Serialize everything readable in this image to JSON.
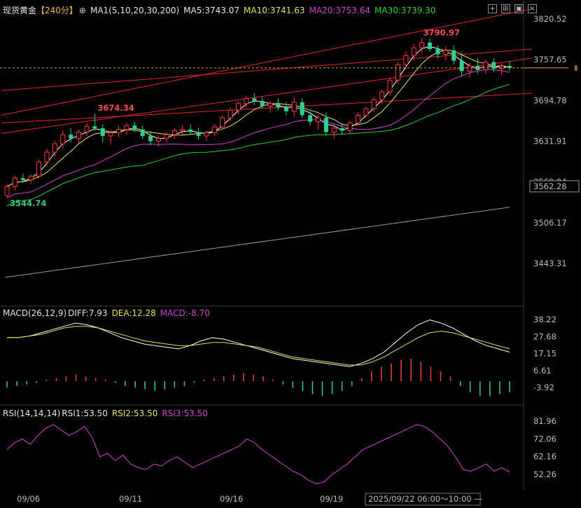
{
  "header": {
    "instrument": "现货黄金",
    "period": "【240分】",
    "zoom_icon": "zoom-in-icon",
    "ma_params": "MA1(5,10,20,30,200)",
    "ma5": "MA5:3743.07",
    "ma10": "MA10:3741.63",
    "ma20": "MA20:3753.64",
    "ma30": "MA30:3739.30"
  },
  "toolbar_icons": [
    "crosshair-icon",
    "split-icon",
    "image-icon",
    "close-icon"
  ],
  "price_axis": [
    "3820.52",
    "3757.65",
    "3694.78",
    "3631.91",
    "3569.04",
    "3506.17",
    "3443.31"
  ],
  "current_price": "3562.28",
  "markers": {
    "high": "3790.97",
    "mid": "3674.34",
    "low": "3544.74"
  },
  "macd": {
    "params": "MACD(26,12,9)",
    "diff": "DIFF:7.93",
    "dea": "DEA:12.28",
    "macd": "MACD:-8.70",
    "axis": [
      "38.22",
      "27.68",
      "17.15",
      "6.61",
      "-3.92"
    ]
  },
  "rsi": {
    "params": "RSI(14,14,14)",
    "rsi1": "RSI1:53.50",
    "rsi2": "RSI2:53.50",
    "rsi3": "RSI3:53.50",
    "axis": [
      "81.96",
      "72.06",
      "62.16",
      "52.26"
    ]
  },
  "dates": [
    "09/06",
    "09/11",
    "09/16",
    "09/19"
  ],
  "cursor_time": "2025/09/22 06:00～10:00",
  "colors": {
    "up": "#ff3b3b",
    "down": "#2fd08f",
    "ma5": "#ffffff",
    "ma10": "#e6e24f",
    "ma20": "#d23fd2",
    "ma30": "#21d321",
    "ma200": "#9a9a9a",
    "channel": "#e8222a"
  },
  "chart_data": {
    "type": "candlestick",
    "y_range": [
      3420,
      3835
    ],
    "candles": [
      [
        3548,
        3566,
        3544.74,
        3562
      ],
      [
        3562,
        3578,
        3556,
        3575
      ],
      [
        3575,
        3582,
        3568,
        3572
      ],
      [
        3572,
        3580,
        3566,
        3578
      ],
      [
        3578,
        3604,
        3575,
        3600
      ],
      [
        3600,
        3620,
        3595,
        3615
      ],
      [
        3615,
        3632,
        3608,
        3628
      ],
      [
        3628,
        3648,
        3620,
        3642
      ],
      [
        3642,
        3652,
        3630,
        3636
      ],
      [
        3636,
        3650,
        3628,
        3646
      ],
      [
        3646,
        3660,
        3640,
        3655
      ],
      [
        3655,
        3674.34,
        3648,
        3652
      ],
      [
        3652,
        3658,
        3630,
        3640
      ],
      [
        3640,
        3650,
        3628,
        3645
      ],
      [
        3645,
        3656,
        3638,
        3650
      ],
      [
        3650,
        3660,
        3642,
        3656
      ],
      [
        3656,
        3662,
        3646,
        3650
      ],
      [
        3650,
        3656,
        3636,
        3640
      ],
      [
        3640,
        3648,
        3626,
        3632
      ],
      [
        3632,
        3640,
        3624,
        3636
      ],
      [
        3636,
        3646,
        3630,
        3642
      ],
      [
        3642,
        3652,
        3636,
        3648
      ],
      [
        3648,
        3656,
        3640,
        3650
      ],
      [
        3650,
        3658,
        3642,
        3646
      ],
      [
        3646,
        3652,
        3634,
        3640
      ],
      [
        3640,
        3648,
        3632,
        3645
      ],
      [
        3645,
        3658,
        3640,
        3654
      ],
      [
        3654,
        3672,
        3650,
        3668
      ],
      [
        3668,
        3684,
        3662,
        3680
      ],
      [
        3680,
        3694,
        3674,
        3690
      ],
      [
        3690,
        3702,
        3684,
        3698
      ],
      [
        3698,
        3706,
        3688,
        3694
      ],
      [
        3694,
        3700,
        3682,
        3686
      ],
      [
        3686,
        3694,
        3676,
        3690
      ],
      [
        3690,
        3698,
        3680,
        3684
      ],
      [
        3684,
        3692,
        3672,
        3678
      ],
      [
        3678,
        3700,
        3670,
        3692
      ],
      [
        3692,
        3698,
        3668,
        3672
      ],
      [
        3672,
        3678,
        3656,
        3662
      ],
      [
        3662,
        3672,
        3650,
        3668
      ],
      [
        3668,
        3676,
        3640,
        3646
      ],
      [
        3646,
        3658,
        3636,
        3652
      ],
      [
        3652,
        3660,
        3642,
        3648
      ],
      [
        3648,
        3664,
        3644,
        3660
      ],
      [
        3660,
        3676,
        3656,
        3672
      ],
      [
        3672,
        3686,
        3668,
        3682
      ],
      [
        3682,
        3700,
        3678,
        3696
      ],
      [
        3696,
        3712,
        3690,
        3708
      ],
      [
        3708,
        3730,
        3702,
        3726
      ],
      [
        3726,
        3754,
        3720,
        3750
      ],
      [
        3750,
        3770,
        3742,
        3764
      ],
      [
        3764,
        3782,
        3756,
        3776
      ],
      [
        3776,
        3790.97,
        3768,
        3784
      ],
      [
        3784,
        3790,
        3770,
        3774
      ],
      [
        3774,
        3780,
        3760,
        3766
      ],
      [
        3766,
        3778,
        3756,
        3772
      ],
      [
        3772,
        3780,
        3750,
        3756
      ],
      [
        3756,
        3768,
        3732,
        3740
      ],
      [
        3740,
        3752,
        3730,
        3748
      ],
      [
        3748,
        3760,
        3736,
        3742
      ],
      [
        3742,
        3758,
        3736,
        3754
      ],
      [
        3754,
        3760,
        3738,
        3744
      ],
      [
        3744,
        3752,
        3734,
        3748
      ],
      [
        3748,
        3756,
        3740,
        3745
      ]
    ],
    "ma200": {
      "from": 3422,
      "to": 3530
    },
    "macd_range": [
      -8,
      42
    ],
    "diff": [
      27,
      27,
      28,
      30,
      32,
      34,
      36,
      35,
      33,
      30,
      27,
      25,
      23,
      22,
      21,
      20,
      22,
      25,
      27,
      26,
      24,
      22,
      20,
      18,
      16,
      14,
      13,
      12,
      11,
      10,
      9,
      11,
      14,
      18,
      24,
      30,
      35,
      38,
      36,
      33,
      29,
      25,
      22,
      20,
      18
    ],
    "dea": [
      27,
      27,
      28,
      29,
      31,
      33,
      34,
      34,
      33,
      31,
      29,
      27,
      25,
      24,
      23,
      22,
      22,
      23,
      24,
      24,
      23,
      22,
      21,
      19,
      17,
      15,
      14,
      13,
      12,
      11,
      10,
      10,
      12,
      15,
      19,
      23,
      27,
      30,
      31,
      30,
      28,
      26,
      24,
      22,
      20
    ],
    "macd_bars": [
      -4,
      -3,
      -2,
      -1,
      1,
      2,
      3,
      4,
      3,
      2,
      1,
      -1,
      -3,
      -4,
      -5,
      -6,
      -5,
      -4,
      -3,
      -1,
      1,
      2,
      3,
      4,
      5,
      4,
      3,
      1,
      -2,
      -4,
      -6,
      -8,
      -9,
      -8,
      -6,
      -3,
      2,
      6,
      9,
      11,
      13,
      14,
      12,
      9,
      6,
      3,
      -3,
      -7,
      -9,
      -9,
      -8,
      -7
    ],
    "rsi_range": [
      44,
      86
    ],
    "rsi": [
      66,
      70,
      72,
      69,
      74,
      78,
      80,
      77,
      74,
      76,
      79,
      73,
      62,
      64,
      60,
      63,
      58,
      56,
      55,
      58,
      57,
      60,
      62,
      59,
      56,
      58,
      60,
      62,
      64,
      66,
      68,
      72,
      70,
      66,
      63,
      60,
      57,
      54,
      52,
      49,
      47,
      48,
      52,
      55,
      58,
      62,
      66,
      68,
      70,
      72,
      74,
      76,
      78,
      80,
      79,
      76,
      72,
      68,
      62,
      55,
      54,
      56,
      58,
      54,
      56,
      53.5
    ]
  }
}
